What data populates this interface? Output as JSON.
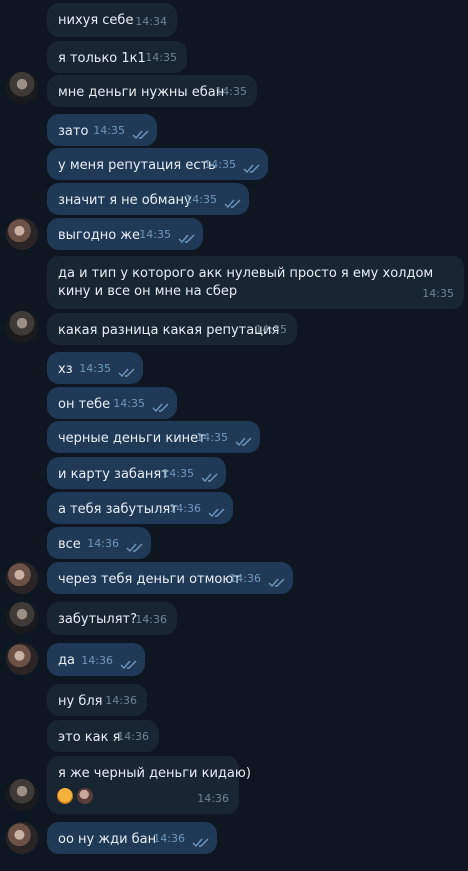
{
  "messages": [
    {
      "text": "нихуя себе",
      "time": "14:34"
    },
    {
      "text": "я только 1к1",
      "time": "14:35"
    },
    {
      "text": "мне деньги нужны ебан",
      "time": "14:35"
    },
    {
      "text": "зато",
      "time": "14:35"
    },
    {
      "text": "у меня репутация есть",
      "time": "14:35"
    },
    {
      "text": "значит я не обману",
      "time": "14:35"
    },
    {
      "text": "выгодно же",
      "time": "14:35"
    },
    {
      "text": "да и тип у которого акк нулевый просто я ему холдом кину и все он мне на сбер",
      "time": "14:35"
    },
    {
      "text": "какая разница какая репутация",
      "time": "14:35"
    },
    {
      "text": "хз",
      "time": "14:35"
    },
    {
      "text": "он тебе",
      "time": "14:35"
    },
    {
      "text": "черные деньги кинет",
      "time": "14:35"
    },
    {
      "text": "и карту забанят",
      "time": "14:35"
    },
    {
      "text": "а тебя забутылят",
      "time": "14:36"
    },
    {
      "text": "все",
      "time": "14:36"
    },
    {
      "text": "через тебя деньги отмоют",
      "time": "14:36"
    },
    {
      "text": "забутылят?",
      "time": "14:36"
    },
    {
      "text": "да",
      "time": "14:36"
    },
    {
      "text": "ну бля",
      "time": "14:36"
    },
    {
      "text": "это как я",
      "time": "14:36"
    },
    {
      "text": "я же черный деньги кидаю)",
      "time": "14:36"
    },
    {
      "text": "оо ну жди бан",
      "time": "14:36"
    }
  ],
  "colors": {
    "background": "#0e1621",
    "incoming": "#182533",
    "outgoing": "#1f3957",
    "check": "#6f97bd"
  },
  "icons": {
    "read_receipt": "double-check-icon",
    "avatar": "user-avatar"
  }
}
